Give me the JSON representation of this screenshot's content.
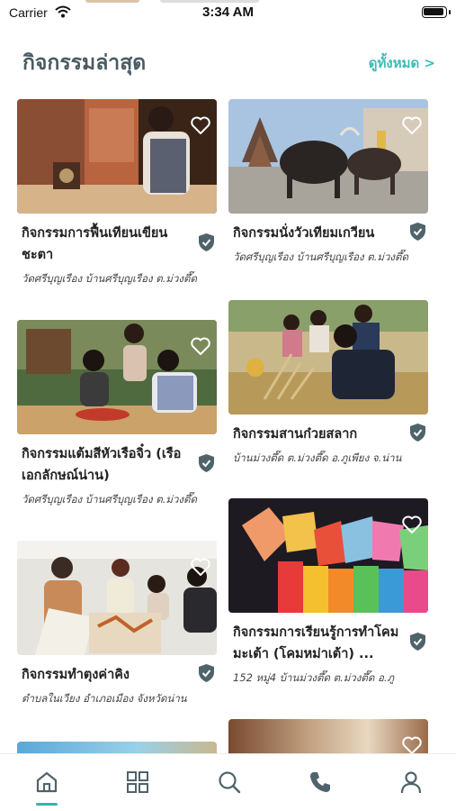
{
  "status_bar": {
    "carrier": "Carrier",
    "time": "3:34 AM"
  },
  "header": {
    "title": "กิจกรรมล่าสุด",
    "see_all": "ดูทั้งหมด >"
  },
  "cards": [
    {
      "name": "กิจกรรมการฟื้นเทียนเขียนชะตา",
      "place": "วัดศรีบุญเรือง บ้านศรีบุญเรือง ต.ม่วงตึ๊ด"
    },
    {
      "name": "กิจกรรมนั่งวัวเทียมเกวียน",
      "place": "วัดศรีบุญเรือง บ้านศรีบุญเรือง ต.ม่วงตึ๊ด"
    },
    {
      "name": "กิจกรรมแต้มสีหัวเรือจิ๋ว (เรือเอกลักษณ์น่าน)",
      "place": "วัดศรีบุญเรือง บ้านศรีบุญเรือง ต.ม่วงตึ๊ด"
    },
    {
      "name": "กิจกรรมสานก๋วยสลาก",
      "place": "บ้านม่วงตึ๊ด ต.ม่วงตึ๊ด อ.ภูเพียง จ.น่าน"
    },
    {
      "name": "กิจกรรมทำตุงค่าคิง",
      "place": "ตำบลในเวียง อำเภอเมือง จังหวัดน่าน"
    },
    {
      "name": "กิจกรรมการเรียนรู้การทำโคมมะเต้า (โคมหม่าเต้า) ...",
      "place": "152 หมู่4 บ้านม่วงตึ๊ด ต.ม่วงตึ๊ด อ.ภู"
    }
  ],
  "tabs": [
    {
      "icon": "home-icon",
      "active": true
    },
    {
      "icon": "grid-icon",
      "active": false
    },
    {
      "icon": "search-icon",
      "active": false
    },
    {
      "icon": "phone-icon",
      "active": false
    },
    {
      "icon": "profile-icon",
      "active": false
    }
  ],
  "colors": {
    "accent": "#3dbdb6",
    "title": "#4b5b63",
    "icon": "#4f636b"
  }
}
